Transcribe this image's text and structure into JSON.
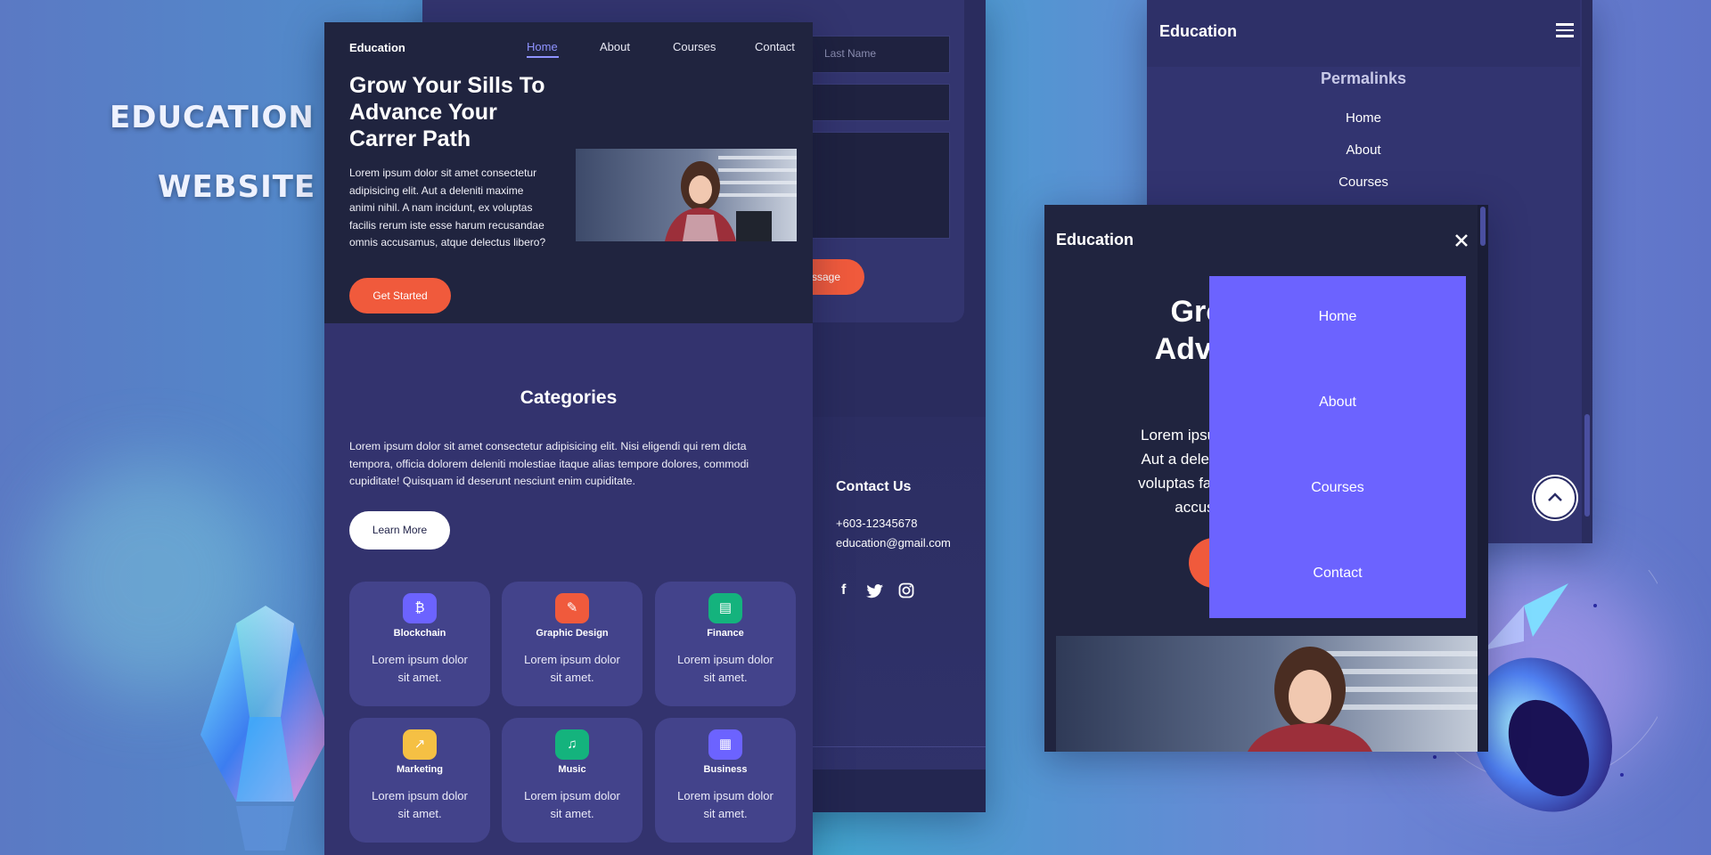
{
  "banner": {
    "line1": "EDUCATION",
    "line2": "WEBSITE"
  },
  "colors": {
    "primary": "#6c63ff",
    "accent": "#f05a3c",
    "dark": "#20243f",
    "panel": "#33336e",
    "card": "#43438b"
  },
  "back_panel": {
    "last_name_placeholder": "Last Name",
    "send_button": "ssage",
    "contact_heading": "Contact Us",
    "phone": "+603-12345678",
    "email": "education@gmail.com",
    "social_icons": [
      "facebook-icon",
      "twitter-icon",
      "instagram-icon"
    ]
  },
  "main": {
    "logo": "Education",
    "nav": [
      "Home",
      "About",
      "Courses",
      "Contact"
    ],
    "hero": {
      "title_lines": [
        "Grow Your Sills To",
        "Advance Your",
        "Carrer Path"
      ],
      "text_lines": [
        "Lorem ipsum dolor sit amet consectetur",
        "adipisicing elit. Aut a deleniti maxime",
        "animi nihil. A nam incidunt, ex voluptas",
        "facilis rerum iste esse harum recusandae",
        "omnis accusamus, atque delectus libero?"
      ],
      "button": "Get Started"
    },
    "categories": {
      "heading": "Categories",
      "text_lines": [
        "Lorem ipsum dolor sit amet consectetur adipisicing elit. Nisi eligendi qui rem dicta",
        "tempora, officia dolorem deleniti molestiae itaque alias tempore dolores, commodi",
        "cupiditate! Quisquam id deserunt nesciunt enim cupiditate."
      ],
      "button": "Learn More",
      "cards": [
        {
          "title": "Blockchain",
          "desc1": "Lorem ipsum dolor",
          "desc2": "sit amet.",
          "icon": "bitcoin-icon",
          "glyph": "₿",
          "color": "#6c63ff"
        },
        {
          "title": "Graphic Design",
          "desc1": "Lorem ipsum dolor",
          "desc2": "sit amet.",
          "icon": "palette-icon",
          "glyph": "✎",
          "color": "#f05a3c"
        },
        {
          "title": "Finance",
          "desc1": "Lorem ipsum dolor",
          "desc2": "sit amet.",
          "icon": "bill-icon",
          "glyph": "▤",
          "color": "#14b37d"
        },
        {
          "title": "Marketing",
          "desc1": "Lorem ipsum dolor",
          "desc2": "sit amet.",
          "icon": "chart-icon",
          "glyph": "↗",
          "color": "#f5c044"
        },
        {
          "title": "Music",
          "desc1": "Lorem ipsum dolor",
          "desc2": "sit amet.",
          "icon": "music-icon",
          "glyph": "♫",
          "color": "#14b37d"
        },
        {
          "title": "Business",
          "desc1": "Lorem ipsum dolor",
          "desc2": "sit amet.",
          "icon": "building-icon",
          "glyph": "▦",
          "color": "#6c63ff"
        }
      ]
    }
  },
  "right_top": {
    "logo": "Education",
    "menu_icon": "hamburger-icon",
    "permalinks_heading": "Permalinks",
    "links": [
      "Home",
      "About",
      "Courses"
    ],
    "scroll_top_icon": "chevron-up-icon"
  },
  "right_overlay": {
    "logo": "Education",
    "close_icon": "close-icon",
    "hero_partial": [
      "Grow",
      "Advanc"
    ],
    "text_partial": [
      "Lorem ipsum dolor s",
      "Aut a deleniti maxim",
      "voluptas facilis rerum",
      "accusamu"
    ],
    "menu": [
      "Home",
      "About",
      "Courses",
      "Contact"
    ]
  }
}
